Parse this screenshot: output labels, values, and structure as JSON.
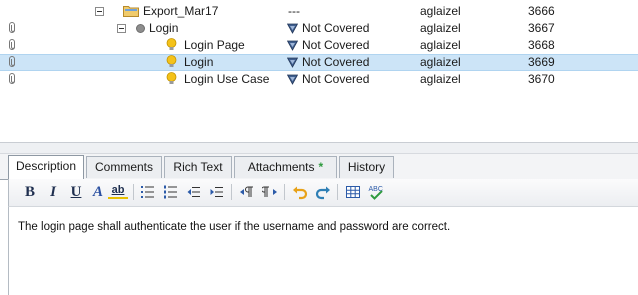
{
  "tree": {
    "rows": [
      {
        "name": "Export_Mar17",
        "status": "---",
        "owner": "aglaizel",
        "id": "3666",
        "icon": "folder-icon"
      },
      {
        "name": "Login",
        "status": "Not Covered",
        "owner": "aglaizel",
        "id": "3667",
        "icon": "gear-icon"
      },
      {
        "name": "Login Page",
        "status": "Not Covered",
        "owner": "aglaizel",
        "id": "3668",
        "icon": "lightbulb-icon"
      },
      {
        "name": "Login",
        "status": "Not Covered",
        "owner": "aglaizel",
        "id": "3669",
        "icon": "lightbulb-icon",
        "selected": true
      },
      {
        "name": "Login Use Case",
        "status": "Not Covered",
        "owner": "aglaizel",
        "id": "3670",
        "icon": "lightbulb-icon"
      }
    ]
  },
  "tabs": {
    "description": "Description",
    "comments": "Comments",
    "rich_text": "Rich Text",
    "attachments": "Attachments",
    "attachments_marker": "*",
    "history": "History"
  },
  "toolbar": {
    "bold": "B",
    "italic": "I",
    "underline": "U",
    "font_color": "A",
    "highlight": "ab"
  },
  "editor": {
    "text": "The login page shall authenticate the user if the username and password are correct."
  },
  "colors": {
    "selection": "#cce4f7",
    "status_icon": "#3f5f8f",
    "bulb": "#f4c21a",
    "folder": "#e8b84a"
  }
}
